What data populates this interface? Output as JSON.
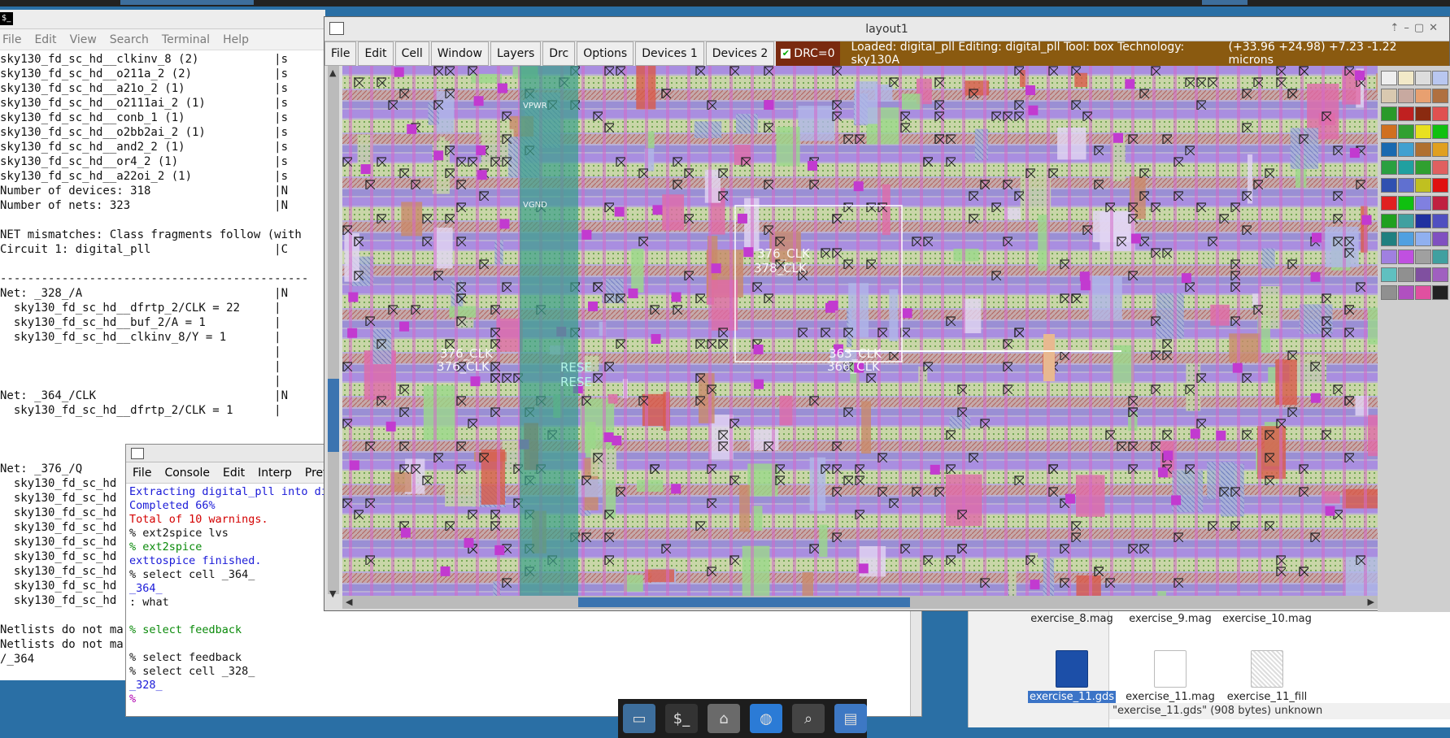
{
  "terminal": {
    "menu": [
      "File",
      "Edit",
      "View",
      "Search",
      "Terminal",
      "Help"
    ],
    "lines": [
      "sky130_fd_sc_hd__clkinv_8 (2)           |s",
      "sky130_fd_sc_hd__o211a_2 (2)            |s",
      "sky130_fd_sc_hd__a21o_2 (1)             |s",
      "sky130_fd_sc_hd__o2111ai_2 (1)          |s",
      "sky130_fd_sc_hd__conb_1 (1)             |s",
      "sky130_fd_sc_hd__o2bb2ai_2 (1)          |s",
      "sky130_fd_sc_hd__and2_2 (1)             |s",
      "sky130_fd_sc_hd__or4_2 (1)              |s",
      "sky130_fd_sc_hd__a22oi_2 (1)            |s",
      "Number of devices: 318                  |N",
      "Number of nets: 323                     |N",
      "",
      "NET mismatches: Class fragments follow (with",
      "Circuit 1: digital_pll                  |C",
      "",
      "---------------------------------------------",
      "Net: _328_/A                            |N",
      "  sky130_fd_sc_hd__dfrtp_2/CLK = 22     |",
      "  sky130_fd_sc_hd__buf_2/A = 1          |",
      "  sky130_fd_sc_hd__clkinv_8/Y = 1       |",
      "                                        |",
      "                                        |",
      "                                        |",
      "Net: _364_/CLK                          |N",
      "  sky130_fd_sc_hd__dfrtp_2/CLK = 1      |",
      "",
      "",
      "",
      "Net: _376_/Q                            |N",
      "  sky130_fd_sc_hd",
      "  sky130_fd_sc_hd",
      "  sky130_fd_sc_hd",
      "  sky130_fd_sc_hd",
      "  sky130_fd_sc_hd",
      "  sky130_fd_sc_hd",
      "  sky130_fd_sc_hd",
      "  sky130_fd_sc_hd",
      "  sky130_fd_sc_hd",
      "",
      "Netlists do not ma",
      "Netlists do not ma",
      "/_364"
    ]
  },
  "tkcon": {
    "menu": [
      "File",
      "Console",
      "Edit",
      "Interp",
      "Prefs"
    ],
    "lines": [
      {
        "t": "Extracting digital_pll into digital_pll.ext:",
        "c": "c-blue"
      },
      {
        "t": "Completed 66%",
        "c": "c-blue"
      },
      {
        "t": "Total of 10 warnings.",
        "c": "c-red"
      },
      {
        "t": "% ext2spice lvs",
        "c": "c-black"
      },
      {
        "t": "% ext2spice",
        "c": "c-green"
      },
      {
        "t": "exttospice finished.",
        "c": "c-blue"
      },
      {
        "t": "% select cell _364_",
        "c": "c-black"
      },
      {
        "t": "_364_",
        "c": "c-blue"
      },
      {
        "t": ": what",
        "c": "c-black"
      },
      {
        "t": "",
        "c": "c-black"
      },
      {
        "t": "% select feedback",
        "c": "c-green"
      },
      {
        "t": "",
        "c": "c-black"
      },
      {
        "t": "% select feedback",
        "c": "c-black"
      },
      {
        "t": "% select cell _328_",
        "c": "c-black"
      },
      {
        "t": "_328_",
        "c": "c-blue"
      },
      {
        "t": "%",
        "c": "c-mag"
      }
    ]
  },
  "layout": {
    "title": "layout1",
    "menu": [
      "File",
      "Edit",
      "Cell",
      "Window",
      "Layers",
      "Drc",
      "Options",
      "Devices 1",
      "Devices 2"
    ],
    "drc": "DRC=0",
    "status": "Loaded: digital_pll  Editing: digital_pll  Tool: box   Technology: sky130A",
    "coords": "(+33.96 +24.98) +7.23 -1.22 microns",
    "labels": {
      "clk1": "376_CLK",
      "clk2": "378_CLK",
      "clk3": "376_CLK",
      "clk4": "376_CLK",
      "clk5": "363_CLK",
      "clk6": "366_CLK",
      "reset1": "RESE",
      "reset2": "RESE",
      "vgnd": "VGND",
      "vpwr": "VPWR"
    }
  },
  "filemanager": {
    "items": [
      {
        "name": "exercise_8.mag",
        "kind": "doc"
      },
      {
        "name": "exercise_9.mag",
        "kind": "doc"
      },
      {
        "name": "exercise_10.mag",
        "kind": "doc"
      },
      {
        "name": "exercise_11.gds",
        "kind": "gds",
        "selected": true
      },
      {
        "name": "exercise_11.mag",
        "kind": "doc"
      },
      {
        "name": "exercise_11_fill",
        "kind": "fill"
      }
    ],
    "status": "\"exercise_11.gds\" (908 bytes) unknown"
  },
  "taskbar": {
    "icons": [
      "desktop-icon",
      "terminal-icon",
      "home-folder-icon",
      "browser-icon",
      "search-icon",
      "folder-icon"
    ]
  },
  "colors": {
    "drc_bg": "#7a2a10",
    "status_bg": "#8a5a10",
    "desktop": "#2a6fa5"
  }
}
